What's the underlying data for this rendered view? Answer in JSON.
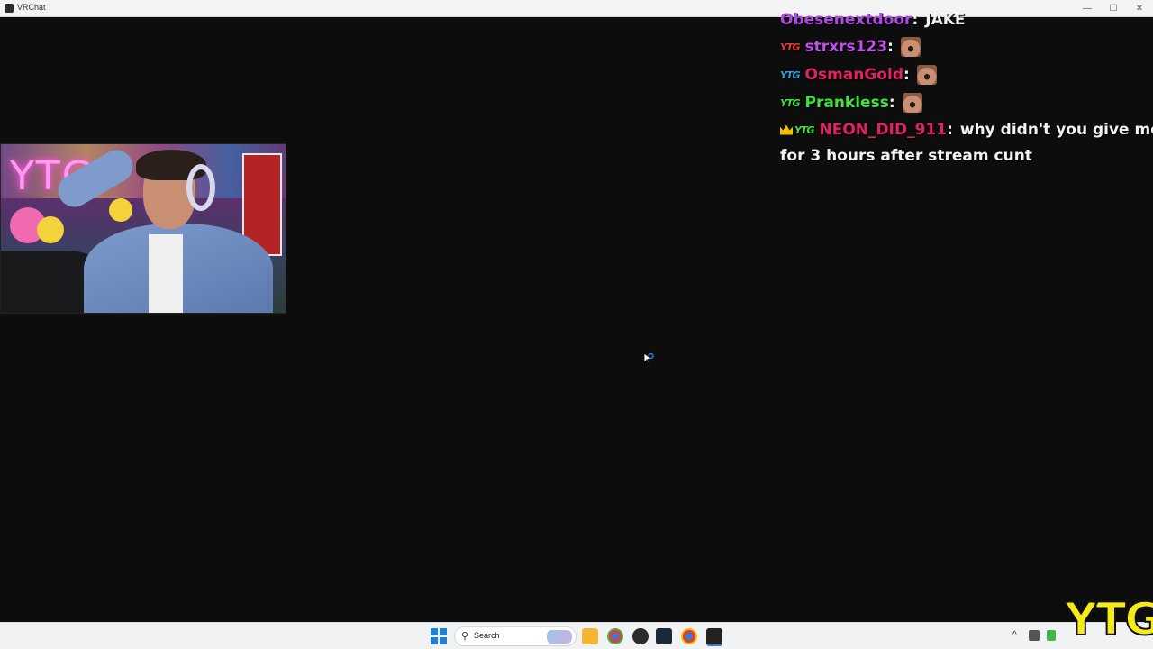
{
  "window": {
    "title": "VRChat",
    "controls": {
      "minimize": "—",
      "maximize": "☐",
      "close": "✕"
    }
  },
  "webcam": {
    "neon_sign": "YTG"
  },
  "chat": {
    "messages": [
      {
        "username": "Obesenextdoor",
        "color": "#b04be0",
        "badges": [],
        "text": "JAKE",
        "emote": false
      },
      {
        "username": "strxrs123",
        "color": "#c24fe6",
        "badges": [
          {
            "label": "YTG",
            "color": "#e23c3c"
          }
        ],
        "text": "",
        "emote": true
      },
      {
        "username": "OsmanGold",
        "color": "#e0245e",
        "badges": [
          {
            "label": "YTG",
            "color": "#2f9fe0"
          }
        ],
        "text": "",
        "emote": true
      },
      {
        "username": "Prankless",
        "color": "#3fe03f",
        "badges": [
          {
            "label": "YTG",
            "color": "#3fe03f"
          }
        ],
        "text": "",
        "emote": true
      },
      {
        "username": "NEON_DID_911",
        "color": "#e0245e",
        "badges": [
          {
            "label": "crown",
            "color": "#f2c200"
          },
          {
            "label": "YTG",
            "color": "#3fe03f"
          }
        ],
        "text": "why didn't you give me",
        "emote": false
      }
    ],
    "continuation": "for 3 hours after stream cunt"
  },
  "taskbar": {
    "search_label": "Search",
    "apps": [
      "windows-start",
      "file-explorer",
      "chrome",
      "obs",
      "steam",
      "chrome-alt",
      "vrchat"
    ]
  },
  "overlay_logo": "YTG"
}
